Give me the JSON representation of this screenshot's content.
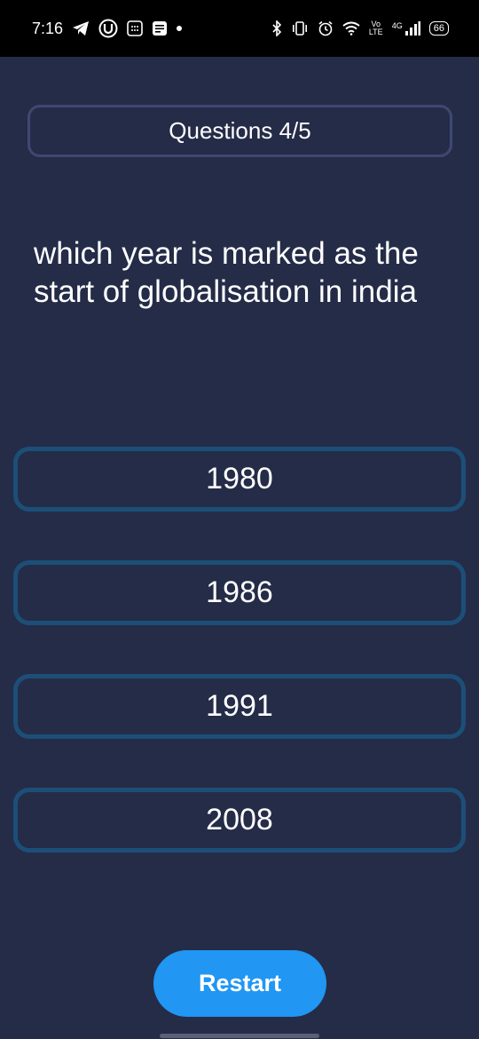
{
  "status_bar": {
    "time": "7:16",
    "network": "4G",
    "volte": "Vo LTE",
    "battery": "66"
  },
  "quiz": {
    "counter": "Questions 4/5",
    "question": "which year is marked as the start of globalisation in india",
    "options": [
      {
        "label": "1980"
      },
      {
        "label": "1986"
      },
      {
        "label": "1991"
      },
      {
        "label": "2008"
      }
    ],
    "restart_label": "Restart"
  },
  "colors": {
    "background": "#252c48",
    "option_border": "#1c4f78",
    "counter_border": "#3f4872",
    "button": "#2196f3"
  }
}
